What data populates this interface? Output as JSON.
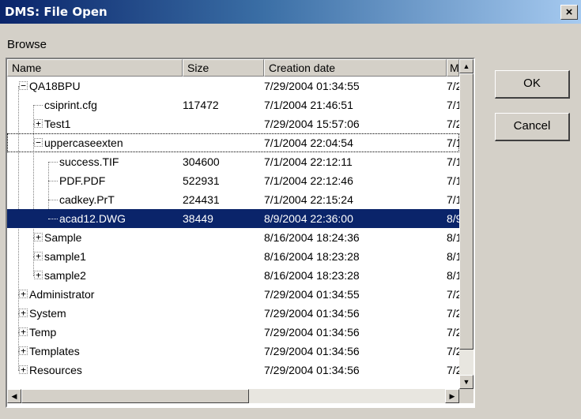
{
  "window": {
    "title": "DMS: File Open",
    "close_glyph": "×"
  },
  "browse": {
    "label": "Browse"
  },
  "columns": {
    "name": "Name",
    "size": "Size",
    "date": "Creation date",
    "mod": "Mo"
  },
  "rows": [
    {
      "name": "QA18BPU",
      "size": "",
      "date": "7/29/2004 01:34:55",
      "mod": "7/2",
      "level": 0,
      "expander": "-"
    },
    {
      "name": "csiprint.cfg",
      "size": "117472",
      "date": "7/1/2004 21:46:51",
      "mod": "7/1",
      "level": 1,
      "expander": ""
    },
    {
      "name": "Test1",
      "size": "",
      "date": "7/29/2004 15:57:06",
      "mod": "7/2",
      "level": 1,
      "expander": "+"
    },
    {
      "name": "uppercaseexten",
      "size": "",
      "date": "7/1/2004 22:04:54",
      "mod": "7/1",
      "level": 1,
      "expander": "-"
    },
    {
      "name": "success.TIF",
      "size": "304600",
      "date": "7/1/2004 22:12:11",
      "mod": "7/1",
      "level": 2,
      "expander": ""
    },
    {
      "name": "PDF.PDF",
      "size": "522931",
      "date": "7/1/2004 22:12:46",
      "mod": "7/1",
      "level": 2,
      "expander": ""
    },
    {
      "name": "cadkey.PrT",
      "size": "224431",
      "date": "7/1/2004 22:15:24",
      "mod": "7/1",
      "level": 2,
      "expander": ""
    },
    {
      "name": "acad12.DWG",
      "size": "38449",
      "date": "8/9/2004 22:36:00",
      "mod": "8/9",
      "level": 2,
      "expander": "",
      "selected": true
    },
    {
      "name": "Sample",
      "size": "",
      "date": "8/16/2004 18:24:36",
      "mod": "8/1",
      "level": 1,
      "expander": "+"
    },
    {
      "name": "sample1",
      "size": "",
      "date": "8/16/2004 18:23:28",
      "mod": "8/1",
      "level": 1,
      "expander": "+"
    },
    {
      "name": "sample2",
      "size": "",
      "date": "8/16/2004 18:23:28",
      "mod": "8/1",
      "level": 1,
      "expander": "+"
    },
    {
      "name": "Administrator",
      "size": "",
      "date": "7/29/2004 01:34:55",
      "mod": "7/2",
      "level": 0,
      "expander": "+"
    },
    {
      "name": "System",
      "size": "",
      "date": "7/29/2004 01:34:56",
      "mod": "7/2",
      "level": 0,
      "expander": "+"
    },
    {
      "name": "Temp",
      "size": "",
      "date": "7/29/2004 01:34:56",
      "mod": "7/2",
      "level": 0,
      "expander": "+"
    },
    {
      "name": "Templates",
      "size": "",
      "date": "7/29/2004 01:34:56",
      "mod": "7/2",
      "level": 0,
      "expander": "+"
    },
    {
      "name": "Resources",
      "size": "",
      "date": "7/29/2004 01:34:56",
      "mod": "7/2",
      "level": 0,
      "expander": "+"
    }
  ],
  "buttons": {
    "ok": "OK",
    "cancel": "Cancel"
  },
  "scroll_glyphs": {
    "up": "▲",
    "down": "▼",
    "left": "◀",
    "right": "▶"
  },
  "colors": {
    "selection": "#0a246a",
    "title_start": "#0a246a",
    "dialog_bg": "#d4d0c8"
  }
}
